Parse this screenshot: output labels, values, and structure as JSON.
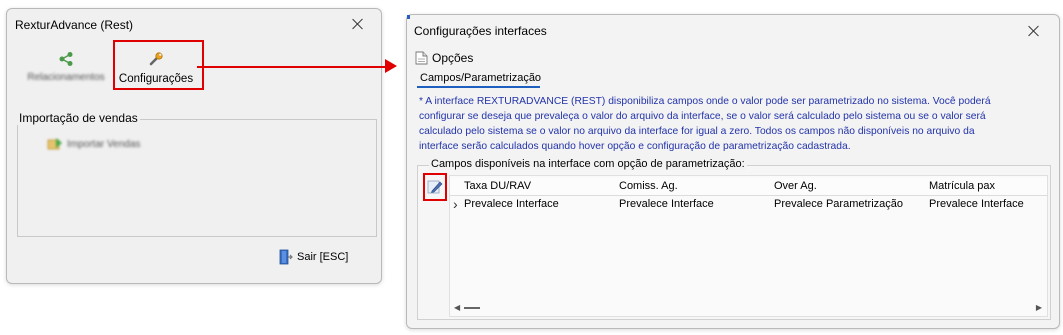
{
  "window_left": {
    "title": "RexturAdvance (Rest)",
    "toolbar": {
      "relacionamentos_label": "Relacionamentos",
      "configuracoes_label": "Configurações"
    },
    "import_group": {
      "legend": "Importação de vendas",
      "importar_label": "Importar Vendas"
    },
    "sair_label": "Sair [ESC]"
  },
  "window_right": {
    "title": "Configurações interfaces",
    "opcoes_label": "Opções",
    "tab_label": "Campos/Parametrização",
    "info_lines": [
      "* A interface REXTURADVANCE (REST) disponibiliza campos onde o valor pode ser parametrizado no sistema. Você poderá",
      "configurar se deseja que prevaleça o valor do arquivo da interface, se o valor será calculado pelo sistema ou se o valor será",
      "calculado pelo sistema se o valor no arquivo da interface for igual a zero. Todos os campos não disponíveis no arquivo da",
      "interface serão calculados quando hover opção e configuração de parametrização cadastrada."
    ],
    "grid": {
      "legend": "Campos disponíveis na interface com opção de parametrização:",
      "columns": [
        "Taxa DU/RAV",
        "Comiss. Ag.",
        "Over Ag.",
        "Matrícula pax"
      ],
      "rows": [
        [
          "Prevalece Interface",
          "Prevalece Interface",
          "Prevalece Parametrização",
          "Prevalece Interface"
        ]
      ],
      "row_indicator": "›"
    }
  },
  "colors": {
    "highlight_red": "#e10000",
    "info_blue": "#2233aa",
    "tab_underline": "#1f5fbf"
  }
}
